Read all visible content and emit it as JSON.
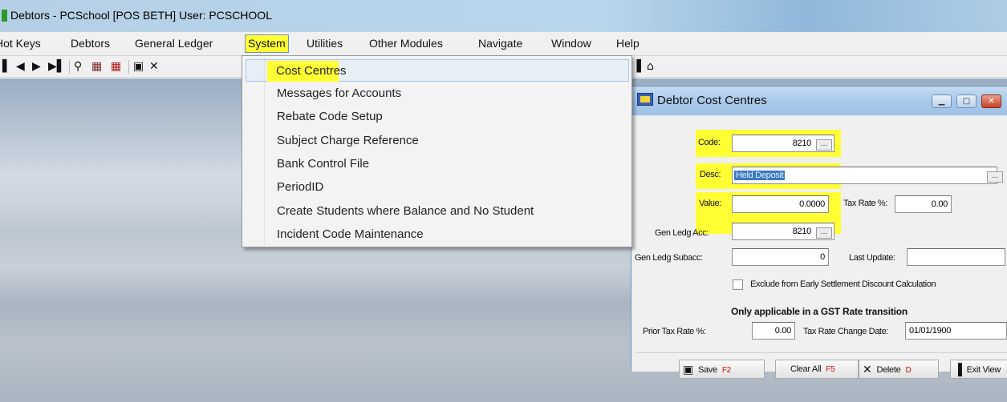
{
  "window": {
    "title": "Debtors - PCSchool [POS BETH]  User: PCSCHOOL"
  },
  "menubar": {
    "items": [
      "Hot Keys",
      "Debtors",
      "General Ledger",
      "System",
      "Utilities",
      "Other Modules",
      "Navigate",
      "Window",
      "Help"
    ],
    "active": "System"
  },
  "toolbar": {
    "icons": [
      "first-record-icon",
      "prev-record-icon",
      "next-record-icon",
      "last-record-icon",
      "search-icon",
      "grid-icon",
      "grid-red-icon",
      "save-icon",
      "delete-icon",
      "door-exit-icon",
      "house-icon"
    ]
  },
  "system_menu": {
    "items": [
      "Cost Centres",
      "Messages for Accounts",
      "Rebate Code Setup",
      "Subject Charge Reference",
      "Bank Control File",
      "PeriodID",
      "Create Students where Balance and No Student",
      "Incident Code Maintenance"
    ],
    "highlighted": "Cost Centres"
  },
  "cost_centre_window": {
    "title": "Debtor Cost Centres",
    "fields": {
      "code": {
        "label": "Code:",
        "value": "8210"
      },
      "desc": {
        "label": "Desc:",
        "value": "Held Deposit"
      },
      "value": {
        "label": "Value:",
        "value": "0.0000"
      },
      "tax_rate": {
        "label": "Tax Rate %:",
        "value": "0.00"
      },
      "gen_ledg_acc": {
        "label": "Gen Ledg Acc:",
        "value": "8210"
      },
      "gen_ledg_subacc": {
        "label": "Gen Ledg Subacc:",
        "value": "0"
      },
      "last_update": {
        "label": "Last Update:",
        "value": ""
      },
      "exclude_checkbox": {
        "label": "Exclude from Early Settlement Discount Calculation",
        "checked": false
      },
      "gst_note": "Only applicable in a GST Rate  transition",
      "prior_tax_rate": {
        "label": "Prior Tax Rate %:",
        "value": "0.00"
      },
      "tax_rate_change_date": {
        "label": "Tax Rate Change Date:",
        "value": "01/01/1900"
      }
    },
    "buttons": {
      "save": {
        "label": "Save",
        "key": "F2"
      },
      "clear_all": {
        "label": "Clear All",
        "key": "F5"
      },
      "delete": {
        "label": "Delete",
        "key": "D"
      },
      "exit_view": {
        "label": "Exit View"
      }
    }
  },
  "colors": {
    "highlight_yellow": "#ffff33",
    "selection_blue": "#3a78c9",
    "titlebar_blue": "#b9d6ec"
  }
}
